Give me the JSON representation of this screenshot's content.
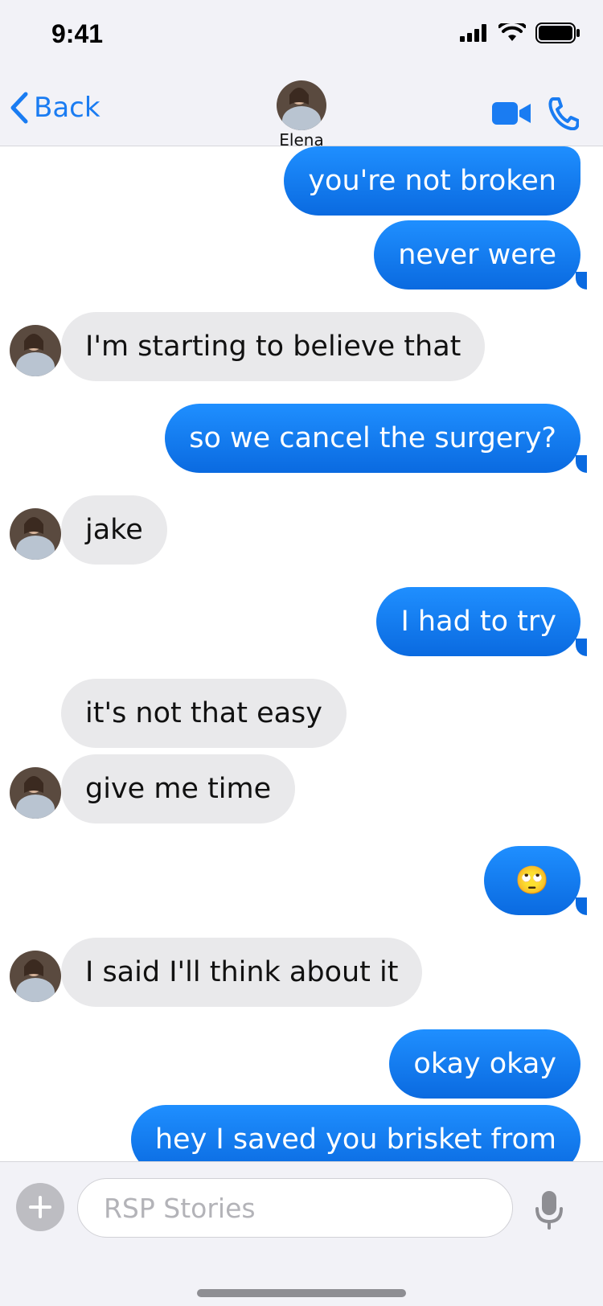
{
  "status_bar": {
    "time": "9:41"
  },
  "header": {
    "back_label": "Back",
    "contact_name": "Elena"
  },
  "messages": [
    {
      "sender": "me",
      "text": "you're not broken"
    },
    {
      "sender": "me",
      "text": "never were"
    },
    {
      "sender": "them",
      "text": "I'm starting to believe that"
    },
    {
      "sender": "me",
      "text": "so we cancel the surgery?"
    },
    {
      "sender": "them",
      "text": "jake"
    },
    {
      "sender": "me",
      "text": "I had to try"
    },
    {
      "sender": "them",
      "text": "it's not that easy"
    },
    {
      "sender": "them",
      "text": "give me time"
    },
    {
      "sender": "me",
      "text": "🙄"
    },
    {
      "sender": "them",
      "text": "I said I'll think about it"
    },
    {
      "sender": "me",
      "text": "okay okay"
    },
    {
      "sender": "me",
      "text": "hey I saved you brisket from"
    }
  ],
  "composer": {
    "placeholder": "RSP Stories"
  },
  "colors": {
    "accent": "#1a7cf2",
    "outgoing_bubble": "#0a6ae0",
    "incoming_bubble": "#e9e9eb"
  }
}
